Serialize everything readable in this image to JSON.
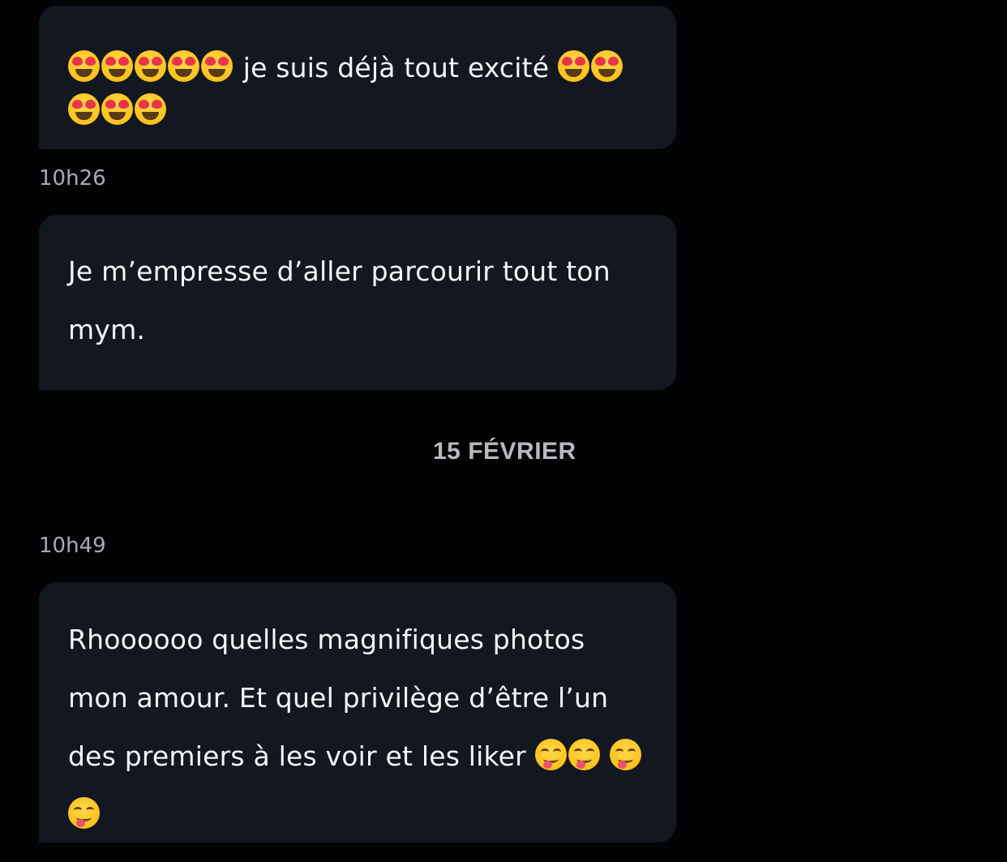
{
  "messages": [
    {
      "text_before": "",
      "lead_emoji": "smiling-face-with-heart-eyes",
      "lead_count": 5,
      "text": "je suis déjà tout excité",
      "trail_emoji": "smiling-face-with-heart-eyes",
      "trail_count": 5
    },
    {
      "text": "Je m’empresse d’aller parcourir tout ton mym."
    },
    {
      "text": "Rhoooooo quelles magnifiques photos mon amour. Et quel privilège d’être l’un des premiers à les voir et les liker",
      "trail_emoji": "face-savoring-food",
      "trail_count": 4
    }
  ],
  "timestamps": [
    "10h26",
    "10h49"
  ],
  "date_separator": "15 FÉVRIER",
  "colors": {
    "background": "#030305",
    "bubble": "#131720",
    "text": "#f4f5f7",
    "timestamp": "#a8abb1",
    "date_separator": "#b8b9bd"
  }
}
